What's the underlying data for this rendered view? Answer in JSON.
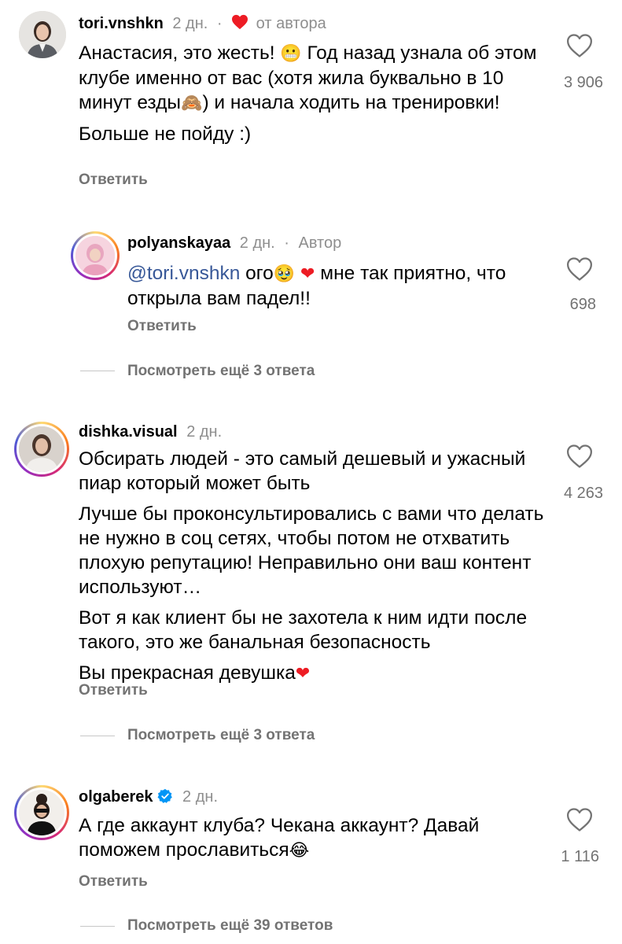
{
  "comments": [
    {
      "username": "tori.vnshkn",
      "time": "2 дн.",
      "by_author": "от автора",
      "paragraphs": [
        {
          "before": "Анастасия, это жесть! ",
          "emoji1": "😬",
          "middle": " Год назад узнала об этом клубе именно от вас (хотя жила буквально в 10 минут езды",
          "emoji2": "🙈",
          "after": ") и начала ходить на тренировки!"
        },
        "Больше не пойду :)"
      ],
      "reply_label": "Ответить",
      "likes": "3 906"
    },
    {
      "username": "polyanskayaa",
      "time": "2 дн.",
      "author_tag": "Автор",
      "mention": "@tori.vnshkn",
      "text_part1": " ого",
      "emoji1": "🥹",
      "emoji2": "❤",
      "text_part2": " мне так приятно, что открыла вам падел!!",
      "reply_label": "Ответить",
      "likes": "698"
    },
    {
      "username": "dishka.visual",
      "time": "2 дн.",
      "paragraphs": [
        "Обсирать людей - это самый дешевый и ужасный пиар который может быть",
        "Лучше бы проконсультировались с вами что делать не нужно в соц сетях, чтобы потом не отхватить плохую репутацию! Неправильно они ваш контент используют…",
        "Вот я как клиент бы не захотела к ним идти после такого, это же банальная безопасность"
      ],
      "last_line": "Вы прекрасная девушка",
      "last_emoji": "❤",
      "reply_label": "Ответить",
      "likes": "4 263"
    },
    {
      "username": "olgaberek",
      "time": "2 дн.",
      "text": "А где аккаунт клуба? Чекана аккаунт? Давай поможем прославиться",
      "emoji": "😂",
      "reply_label": "Ответить",
      "likes": "1 116"
    }
  ],
  "view_more": [
    "Посмотреть ещё 3 ответа",
    "Посмотреть ещё 3 ответа",
    "Посмотреть ещё 39 ответов"
  ],
  "colors": {
    "heart_red": "#ed1c24",
    "mention_blue": "#385898",
    "verified_blue": "#0095f6",
    "secondary_gray": "#737373"
  },
  "icons": [
    "heart-outline-icon",
    "liked-by-author-heart-icon",
    "verified-badge-icon"
  ]
}
